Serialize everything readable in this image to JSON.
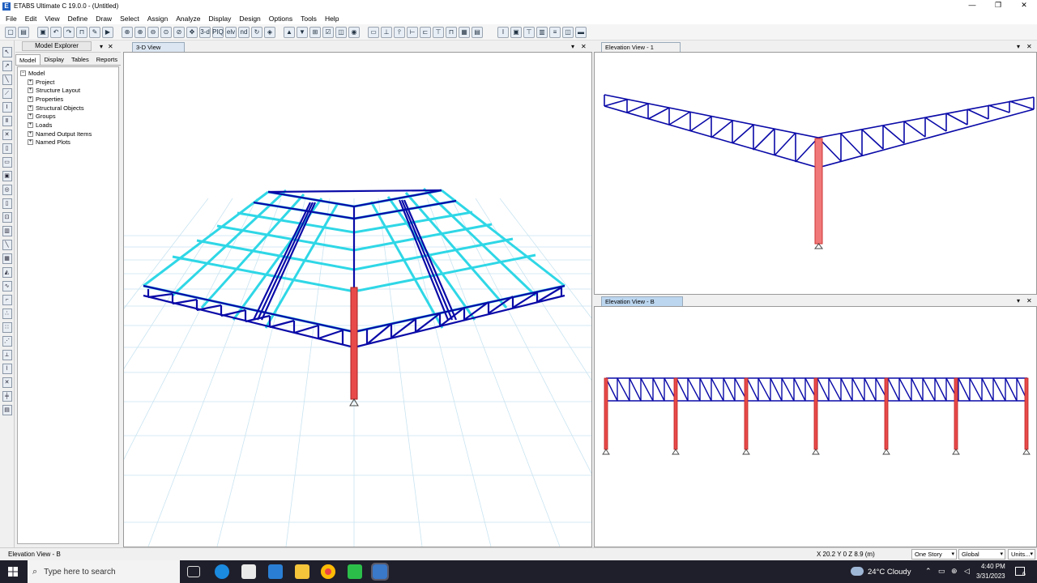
{
  "window": {
    "title": "ETABS Ultimate C 19.0.0 - (Untitled)",
    "app_icon": "E",
    "minimize": "—",
    "restore": "❐",
    "close": "✕"
  },
  "menu": [
    "File",
    "Edit",
    "View",
    "Define",
    "Draw",
    "Select",
    "Assign",
    "Analyze",
    "Display",
    "Design",
    "Options",
    "Tools",
    "Help"
  ],
  "toolbar": {
    "icons": [
      "new-icon",
      "open-icon",
      "save-icon",
      "undo-icon",
      "redo-icon",
      "lock-icon",
      "pencil-icon",
      "run-icon",
      "zoom-window-icon",
      "zoom-in-icon",
      "zoom-out-icon",
      "zoom-extents-icon",
      "zoom-previous-icon",
      "pan-icon",
      "3d-view-icon",
      "plan-view-icon",
      "elevation-view-icon",
      "rotate-icon",
      "perspective-icon",
      "move-up-icon",
      "move-down-icon",
      "object-shrink-icon",
      "set-display-icon",
      "show-icon",
      "grid-icon",
      "options-icon"
    ],
    "labels": [
      "3-d",
      "PIQ",
      "elv",
      "nd"
    ]
  },
  "left_tools": [
    "select-pointer-icon",
    "reshape-icon",
    "draw-frame-icon",
    "draw-brace-icon",
    "draw-beam-icon",
    "draw-column-icon",
    "draw-cross-icon",
    "draw-floor-icon",
    "draw-wall-icon",
    "draw-opening-icon",
    "draw-area-icon",
    "draw-link-icon",
    "draw-point-icon",
    "draw-grid-icon",
    "draw-section-cut-icon",
    "draw-dimension-icon",
    "draw-developed-elevation-icon",
    "draw-reference-point-icon",
    "draw-wall-stack-icon",
    "snap-points-icon",
    "snap-ends-icon",
    "snap-intersections-icon",
    "snap-perpendicular-icon",
    "snap-lines-icon",
    "snap-fine-grid-icon"
  ],
  "explorer": {
    "title": "Model Explorer",
    "pin": "▾",
    "close": "✕",
    "tabs": [
      "Model",
      "Display",
      "Tables",
      "Reports"
    ],
    "root": "Model",
    "items": [
      "Project",
      "Structure Layout",
      "Properties",
      "Structural Objects",
      "Groups",
      "Loads",
      "Named Output Items",
      "Named Plots"
    ],
    "expand_symbol": "+",
    "collapse_symbol": "−"
  },
  "views": {
    "view3d": {
      "tab": "3-D View",
      "menu": "▾",
      "close": "✕"
    },
    "elev1": {
      "tab": "Elevation View - 1",
      "menu": "▾",
      "close": "✕"
    },
    "elevB": {
      "tab": "Elevation View - B",
      "menu": "▾",
      "close": "✕"
    }
  },
  "colors": {
    "truss": "#0a0aa8",
    "purlin": "#2fd7e6",
    "column": "#e84a4a",
    "grid": "#bfe0ef"
  },
  "status": {
    "left": "Elevation View - B",
    "coords": "X 20.2  Y 0  Z 8.9 (m)",
    "story": "One Story",
    "coord_sys": "Global",
    "units": "Units..."
  },
  "taskbar": {
    "search": "Type here to search",
    "weather": "24°C  Cloudy",
    "time": "4:40 PM",
    "date": "3/31/2023",
    "notifications": "6"
  }
}
